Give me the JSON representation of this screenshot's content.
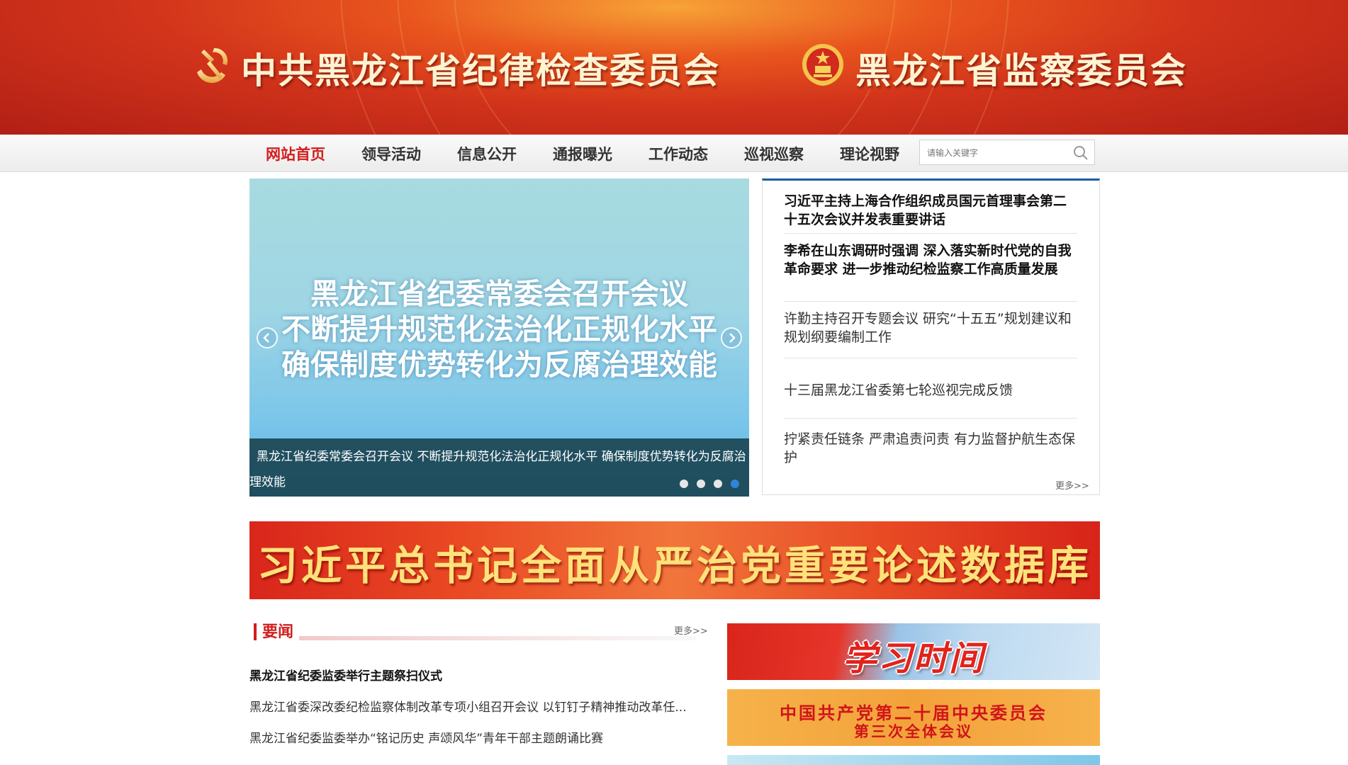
{
  "header": {
    "left_title": "中共黑龙江省纪律检查委员会",
    "right_title": "黑龙江省监察委员会"
  },
  "nav": {
    "items": [
      "网站首页",
      "领导活动",
      "信息公开",
      "通报曝光",
      "工作动态",
      "巡视巡察",
      "理论视野"
    ],
    "active_index": 0,
    "search_placeholder": "请输入关键字"
  },
  "slider": {
    "slide_lines": [
      "黑龙江省纪委常委会召开会议",
      "不断提升规范化法治化正规化水平",
      "确保制度优势转化为反腐治理效能"
    ],
    "caption": "黑龙江省纪委常委会召开会议 不断提升规范化法治化正规化水平 确保制度优势转化为反腐治理效能",
    "dot_count": 4,
    "active_dot": 3
  },
  "headlines": {
    "items": [
      {
        "text": "习近平主持上海合作组织成员国元首理事会第二十五次会议并发表重要讲话",
        "bold": true
      },
      {
        "text": "李希在山东调研时强调 深入落实新时代党的自我革命要求 进一步推动纪检监察工作高质量发展",
        "bold": true
      },
      {
        "text": "许勤主持召开专题会议 研究“十五五”规划建议和规划纲要编制工作",
        "bold": false
      },
      {
        "text": "十三届黑龙江省委第七轮巡视完成反馈",
        "bold": false
      },
      {
        "text": "拧紧责任链条 严肃追责问责 有力监督护航生态保护",
        "bold": false
      }
    ],
    "more": "更多>>"
  },
  "big_banner": {
    "text": "习近平总书记全面从严治党重要论述数据库"
  },
  "news": {
    "title": "要闻",
    "more": "更多>>",
    "items": [
      {
        "text": "黑龙江省纪委监委举行主题祭扫仪式",
        "bold": true
      },
      {
        "text": "黑龙江省委深改委纪检监察体制改革专项小组召开会议 以钉钉子精神推动改革任...",
        "bold": false
      },
      {
        "text": "黑龙江省纪委监委举办“铭记历史 声颂风华”青年干部主题朗诵比赛",
        "bold": false
      }
    ]
  },
  "side_banners": {
    "study_time": "学习时间",
    "plenum_line1": "中国共产党第二十届中央委员会",
    "plenum_line2": "第三次全体会议"
  },
  "colors": {
    "accent_red": "#d21d1d",
    "headline_border_blue": "#1f5aa8",
    "active_dot_blue": "#2f86d4"
  }
}
